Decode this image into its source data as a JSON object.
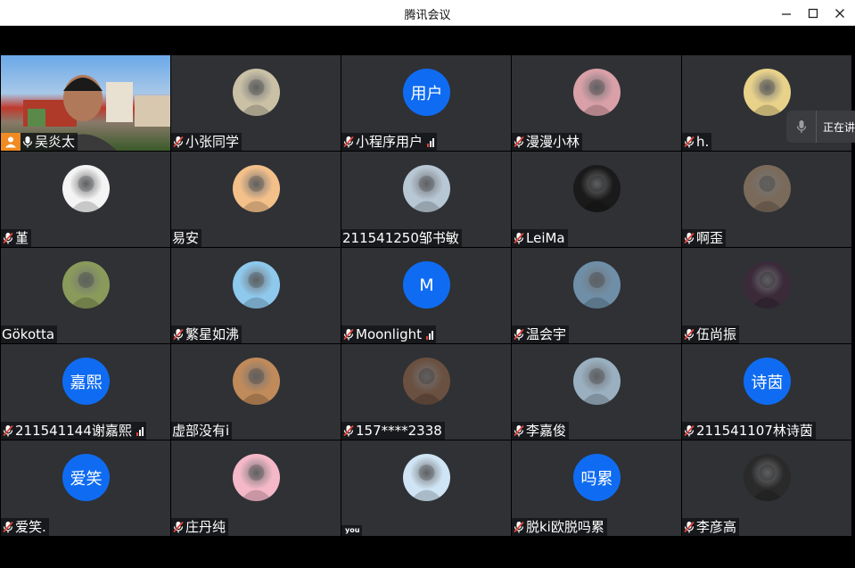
{
  "window": {
    "title": "腾讯会议",
    "controls": [
      "minimize-icon",
      "maximize-icon",
      "close-icon"
    ]
  },
  "speaking": {
    "label": "正在讲"
  },
  "participants": [
    {
      "name": "吴炎太",
      "host": true,
      "muted": false,
      "signal": false,
      "avatar": "video"
    },
    {
      "name": "小张同学",
      "muted": true,
      "signal": false,
      "avatar": "photo",
      "color": "#c9c0a6"
    },
    {
      "name": "小程序用户",
      "muted": true,
      "signal": true,
      "avatar_text": "用户"
    },
    {
      "name": "漫漫小林",
      "muted": true,
      "signal": false,
      "avatar": "photo",
      "color": "#d9a0a8"
    },
    {
      "name": "h.",
      "muted": true,
      "signal": false,
      "avatar": "photo",
      "color": "#e8d28a"
    },
    {
      "name": "堇",
      "muted": true,
      "signal": false,
      "avatar": "photo",
      "color": "#f4f4f4"
    },
    {
      "name": "易安",
      "muted": false,
      "signal": false,
      "avatar": "photo",
      "color": "#f4c08a"
    },
    {
      "name": "211541250邹书敏",
      "muted": false,
      "signal": false,
      "avatar": "photo",
      "color": "#b8c7d4"
    },
    {
      "name": "LeiMa",
      "muted": true,
      "signal": false,
      "avatar": "photo",
      "color": "#1a1a1a"
    },
    {
      "name": "啊歪",
      "muted": true,
      "signal": false,
      "avatar": "photo",
      "color": "#7a6a5a"
    },
    {
      "name": "Gökotta",
      "muted": false,
      "signal": false,
      "avatar": "photo",
      "color": "#8a9a5a"
    },
    {
      "name": "繁星如沸",
      "muted": true,
      "signal": false,
      "avatar": "photo",
      "color": "#8ec8ec"
    },
    {
      "name": "Moonlight",
      "muted": true,
      "signal": true,
      "avatar_text": "M"
    },
    {
      "name": "温会宇",
      "muted": true,
      "signal": false,
      "avatar": "photo",
      "color": "#6f8fa8"
    },
    {
      "name": "伍尚振",
      "muted": true,
      "signal": false,
      "avatar": "photo",
      "color": "#3a2a3a"
    },
    {
      "name": "211541144谢嘉熙",
      "muted": true,
      "signal": true,
      "avatar_text": "嘉熙"
    },
    {
      "name": "虚部没有i",
      "muted": false,
      "signal": false,
      "avatar": "photo",
      "color": "#c08a5a"
    },
    {
      "name": "157****2338",
      "muted": true,
      "signal": false,
      "avatar": "photo",
      "color": "#6a5040"
    },
    {
      "name": "李嘉俊",
      "muted": true,
      "signal": false,
      "avatar": "photo",
      "color": "#9ab0c0"
    },
    {
      "name": "211541107林诗茵",
      "muted": true,
      "signal": false,
      "avatar_text": "诗茵"
    },
    {
      "name": "爱笑.",
      "muted": true,
      "signal": false,
      "avatar_text": "爱笑"
    },
    {
      "name": "庄丹纯",
      "muted": true,
      "signal": false,
      "avatar": "photo",
      "color": "#f4b8c8"
    },
    {
      "name": "you",
      "muted": false,
      "signal": false,
      "avatar": "photo",
      "color": "#cfe4f4",
      "small": true
    },
    {
      "name": "脱ki欧脱吗累",
      "muted": true,
      "signal": false,
      "avatar_text": "吗累"
    },
    {
      "name": "李彦高",
      "muted": true,
      "signal": false,
      "avatar": "photo",
      "color": "#2a2a2a"
    }
  ],
  "colors": {
    "tile_bg": "#2f3135",
    "avatar_blue": "#0f6cf2",
    "mute_red": "#e0433a",
    "host_orange": "#f08a24"
  }
}
